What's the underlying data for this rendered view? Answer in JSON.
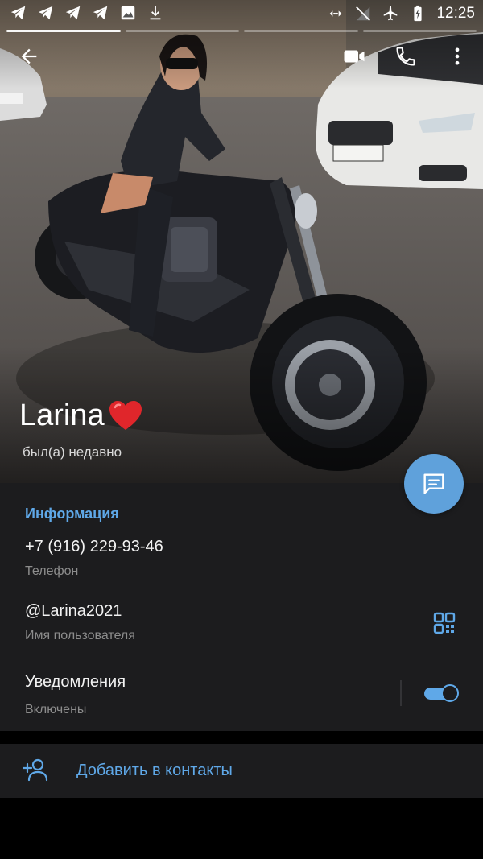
{
  "status_bar": {
    "time": "12:25",
    "left_icons": [
      "telegram-icon",
      "telegram-icon",
      "telegram-icon",
      "telegram-icon",
      "image-icon",
      "download-icon"
    ],
    "right_icons": [
      "data-saver-icon",
      "no-signal-icon",
      "airplane-icon",
      "battery-charging-icon"
    ]
  },
  "profile": {
    "name": "Larina",
    "name_emoji": "heart-emoji",
    "status": "был(а) недавно",
    "story_segments": 4,
    "active_segment": 1
  },
  "toolbar": {
    "back": "back-arrow-icon",
    "video": "video-call-icon",
    "call": "phone-icon",
    "more": "more-vertical-icon"
  },
  "info": {
    "title": "Информация",
    "phone": {
      "value": "+7 (916) 229-93-46",
      "label": "Телефон"
    },
    "username": {
      "value": "@Larina2021",
      "label": "Имя пользователя"
    },
    "notifications": {
      "value": "Уведомления",
      "label": "Включены",
      "enabled": true
    }
  },
  "actions": {
    "add_contact": "Добавить в контакты"
  },
  "colors": {
    "accent": "#5fa8e8",
    "fab": "#5fa1db",
    "panel": "#1c1c1e",
    "background": "#000000"
  }
}
